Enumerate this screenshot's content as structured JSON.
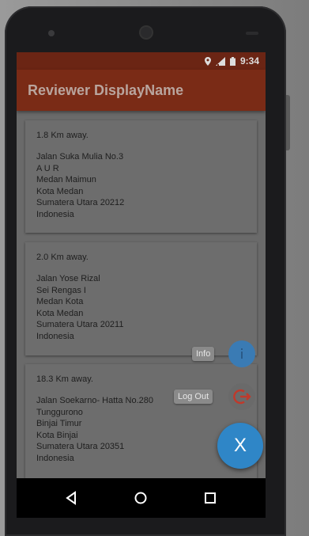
{
  "status_bar": {
    "time": "9:34"
  },
  "app": {
    "title": "Reviewer DisplayName"
  },
  "places": [
    {
      "distance": "1.8 Km away.",
      "address_lines": [
        "Jalan Suka Mulia No.3",
        "A U R",
        "Medan Maimun",
        "Kota Medan",
        "Sumatera Utara 20212",
        "Indonesia"
      ]
    },
    {
      "distance": "2.0 Km away.",
      "address_lines": [
        "Jalan Yose Rizal",
        "Sei Rengas I",
        "Medan Kota",
        "Kota Medan",
        "Sumatera Utara 20211",
        "Indonesia"
      ]
    },
    {
      "distance": "18.3 Km away.",
      "address_lines": [
        "Jalan Soekarno- Hatta No.280",
        "Tunggurono",
        "Binjai Timur",
        "Kota Binjai",
        "Sumatera Utara 20351",
        "Indonesia"
      ]
    }
  ],
  "fab_menu": {
    "info_label": "Info",
    "logout_label": "Log Out",
    "close_label": "X",
    "info_icon": "info-icon",
    "logout_icon": "logout-icon"
  },
  "navigation": {
    "back_icon": "back-icon",
    "home_icon": "home-icon",
    "recents_icon": "recents-icon"
  },
  "colors": {
    "appbar": "#7a2b16",
    "status_bar": "#6b2514",
    "fab": "#2f86c7",
    "logout_icon": "#c0392b"
  }
}
